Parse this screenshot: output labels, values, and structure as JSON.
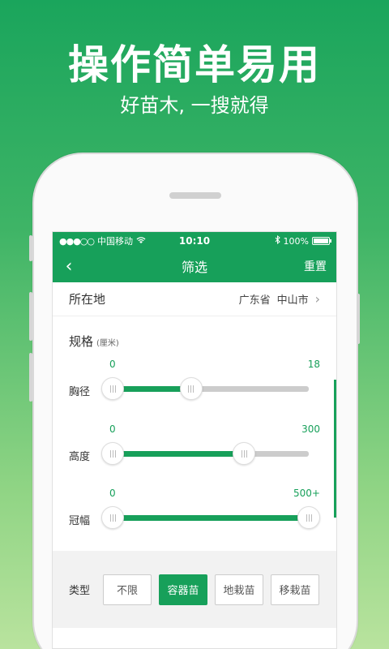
{
  "promo": {
    "headline": "操作简单易用",
    "subline": "好苗木, 一搜就得"
  },
  "status_bar": {
    "carrier": "中国移动",
    "time": "10:10",
    "battery": "100%",
    "signal_dots": "●●●○○"
  },
  "nav": {
    "back_icon": "‹",
    "title": "筛选",
    "reset_label": "重置"
  },
  "location": {
    "label": "所在地",
    "province": "广东省",
    "city": "中山市",
    "chevron": "›"
  },
  "spec": {
    "title": "规格",
    "unit": "(厘米)",
    "sliders": [
      {
        "label": "胸径",
        "min": "0",
        "max": "18",
        "value": 0.4
      },
      {
        "label": "高度",
        "min": "0",
        "max": "300",
        "value": 0.67
      },
      {
        "label": "冠幅",
        "min": "0",
        "max": "500+",
        "value": 1.0
      }
    ]
  },
  "type": {
    "label": "类型",
    "options": [
      "不限",
      "容器苗",
      "地栽苗",
      "移栽苗"
    ],
    "selected_index": 1
  },
  "colors": {
    "accent": "#17a05a"
  }
}
